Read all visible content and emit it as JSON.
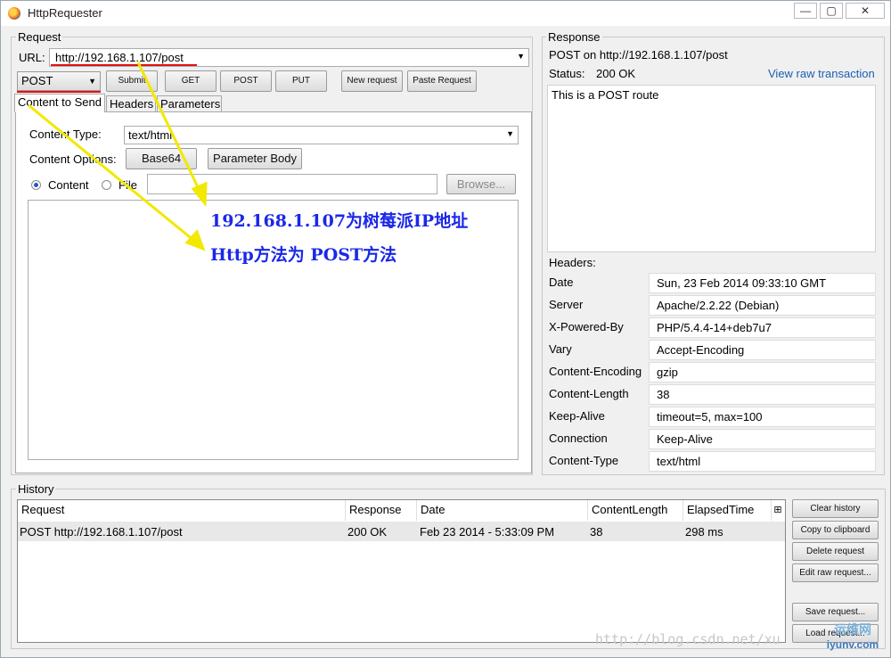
{
  "window": {
    "title": "HttpRequester",
    "min_glyph": "—",
    "max_glyph": "▢",
    "close_glyph": "✕"
  },
  "request": {
    "group_label": "Request",
    "url_label": "URL:",
    "url_value": "http://192.168.1.107/post",
    "method_value": "POST",
    "buttons": {
      "submit": "Submit",
      "get": "GET",
      "post": "POST",
      "put": "PUT",
      "new_request": "New request",
      "paste_request": "Paste Request"
    },
    "tabs": [
      "Content to Send",
      "Headers",
      "Parameters"
    ],
    "content_type_label": "Content Type:",
    "content_type_value": "text/html",
    "content_options_label": "Content Options:",
    "base64_label": "Base64",
    "parameter_body_label": "Parameter Body",
    "radio_content_label": "Content",
    "radio_file_label": "File",
    "browse_label": "Browse..."
  },
  "response": {
    "group_label": "Response",
    "summary": "POST on http://192.168.1.107/post",
    "status_label": "Status:",
    "status_value": "200 OK",
    "raw_link": "View raw transaction",
    "body": "This is a POST route",
    "headers_label": "Headers:",
    "headers": [
      {
        "name": "Date",
        "value": "Sun, 23 Feb 2014 09:33:10 GMT"
      },
      {
        "name": "Server",
        "value": "Apache/2.2.22 (Debian)"
      },
      {
        "name": "X-Powered-By",
        "value": "PHP/5.4.4-14+deb7u7"
      },
      {
        "name": "Vary",
        "value": "Accept-Encoding"
      },
      {
        "name": "Content-Encoding",
        "value": "gzip"
      },
      {
        "name": "Content-Length",
        "value": "38"
      },
      {
        "name": "Keep-Alive",
        "value": "timeout=5, max=100"
      },
      {
        "name": "Connection",
        "value": "Keep-Alive"
      },
      {
        "name": "Content-Type",
        "value": "text/html"
      }
    ]
  },
  "history": {
    "group_label": "History",
    "columns": [
      "Request",
      "Response",
      "Date",
      "ContentLength",
      "ElapsedTime"
    ],
    "rows": [
      {
        "request": "POST http://192.168.1.107/post",
        "response": "200 OK",
        "date": "Feb 23 2014 - 5:33:09 PM",
        "content_length": "38",
        "elapsed": "298 ms"
      }
    ],
    "buttons": {
      "clear": "Clear history",
      "copy": "Copy to clipboard",
      "delete": "Delete request",
      "edit_raw": "Edit raw request...",
      "save": "Save request...",
      "load": "Load request..."
    }
  },
  "annotations": {
    "line1": "192.168.1.107为树莓派IP地址",
    "line2": "Http方法为 POST方法",
    "arrow_color": "#f2e800",
    "text_color": "#1a28e8"
  },
  "watermark": {
    "text": "http://blog.csdn.net/xu",
    "logo_text": "运维网",
    "logo_sub": "iyunv.com"
  }
}
